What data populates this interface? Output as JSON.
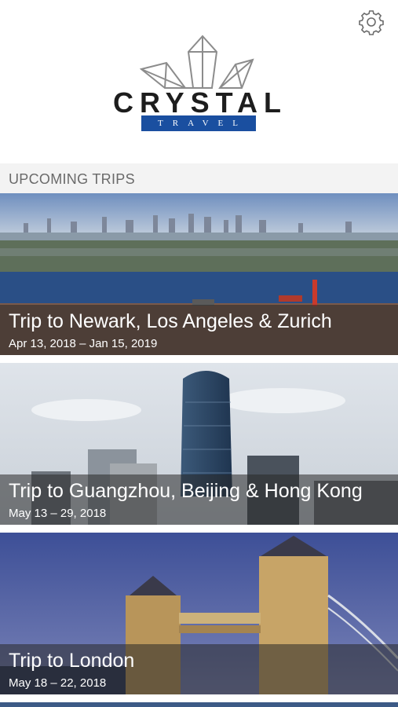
{
  "app": {
    "brand_word": "CRYSTAL",
    "brand_sub": "TRAVEL"
  },
  "header": {
    "settings_icon": "gear-icon"
  },
  "section": {
    "title": "UPCOMING TRIPS"
  },
  "trips": [
    {
      "title": "Trip to Newark, Los Angeles & Zurich",
      "dates": "Apr 13, 2018 – Jan 15, 2019"
    },
    {
      "title": "Trip to Guangzhou, Beijing & Hong Kong",
      "dates": "May 13 – 29, 2018"
    },
    {
      "title": "Trip to London",
      "dates": "May 18 – 22, 2018"
    }
  ],
  "colors": {
    "brand_blue": "#1a4fa0",
    "caption_overlay": "#282828"
  }
}
